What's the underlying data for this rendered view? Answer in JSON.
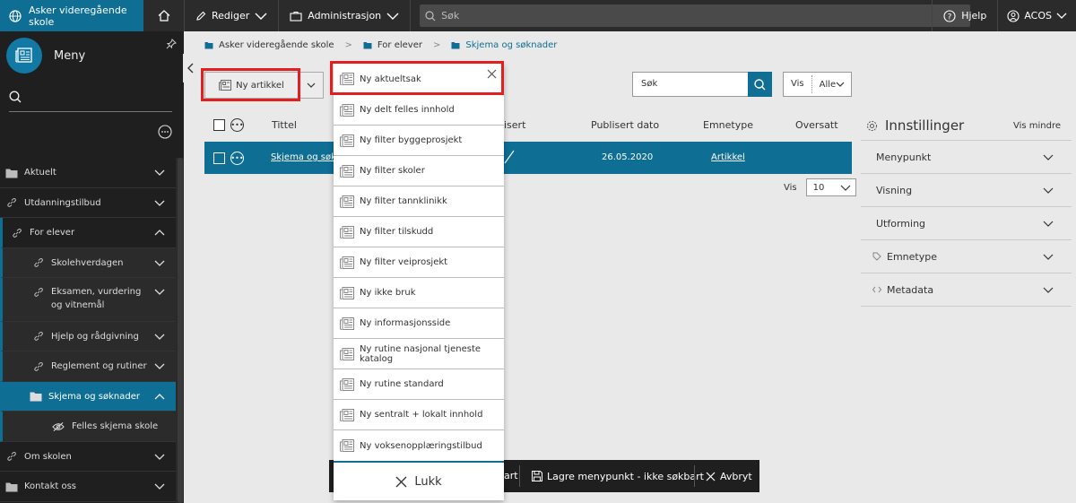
{
  "topbar": {
    "site": "Asker videregående skole",
    "edit": "Rediger",
    "admin": "Administrasjon",
    "search_placeholder": "Søk",
    "help": "Hjelp",
    "user": "ACOS"
  },
  "sidebar": {
    "title": "Meny",
    "items": [
      {
        "label": "Aktuelt",
        "icon": "folder-icon"
      },
      {
        "label": "Utdanningstilbud",
        "icon": "link-icon"
      },
      {
        "label": "For elever",
        "icon": "link-icon"
      },
      {
        "label": "Skolehverdagen",
        "icon": "link-icon"
      },
      {
        "label": "Eksamen, vurdering og vitnemål",
        "icon": "link-icon"
      },
      {
        "label": "Hjelp og rådgivning",
        "icon": "link-icon"
      },
      {
        "label": "Reglement og rutiner",
        "icon": "link-icon"
      },
      {
        "label": "Skjema og søknader",
        "icon": "folder-icon"
      },
      {
        "label": "Felles skjema skole",
        "icon": "eye-slash-icon"
      },
      {
        "label": "Om skolen",
        "icon": "link-icon"
      },
      {
        "label": "Kontakt oss",
        "icon": "folder-icon"
      }
    ]
  },
  "breadcrumb": [
    "Asker videregående skole",
    "For elever",
    "Skjema og søknader"
  ],
  "toolbar": {
    "new_article": "Ny artikkel",
    "search_value": "Søk",
    "vis_label": "Vis",
    "vis_value": "Alle"
  },
  "table": {
    "headers": [
      "Tittel",
      "isert",
      "Publisert dato",
      "Emnetype",
      "Oversatt"
    ],
    "row": {
      "title": "Skjema og søkna",
      "date": "26.05.2020",
      "type": "Artikkel"
    },
    "pager_label": "Vis",
    "pager_value": "10"
  },
  "settings": {
    "title": "Innstillinger",
    "toggle": "Vis mindre",
    "items": [
      "Menypunkt",
      "Visning",
      "Utforming",
      "Emnetype",
      "Metadata"
    ]
  },
  "actionbar": {
    "save_fragment": "art",
    "save_menu": "Lagre menypunkt - ikke søkbart",
    "cancel": "Avbryt"
  },
  "dropdown": {
    "items": [
      "Ny aktueltsak",
      "Ny delt felles innhold",
      "Ny filter byggeprosjekt",
      "Ny filter skoler",
      "Ny filter tannklinikk",
      "Ny filter tilskudd",
      "Ny filter veiprosjekt",
      "Ny ikke bruk",
      "Ny informasjonsside",
      "Ny rutine nasjonal tjeneste katalog",
      "Ny rutine standard",
      "Ny sentralt + lokalt innhold",
      "Ny voksenopplæringstilbud"
    ],
    "close": "Lukk"
  },
  "colors": {
    "accent": "#0e6e94",
    "highlight": "#e31e1e",
    "dark": "#1f1f1f"
  }
}
